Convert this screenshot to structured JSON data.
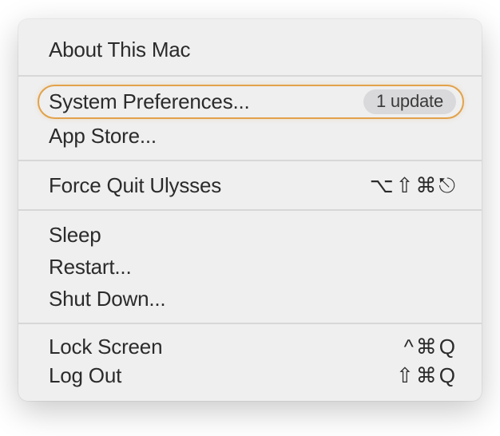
{
  "menu": {
    "about": {
      "label": "About This Mac"
    },
    "system_prefs": {
      "label": "System Preferences...",
      "badge": "1 update"
    },
    "app_store": {
      "label": "App Store..."
    },
    "force_quit": {
      "label": "Force Quit Ulysses",
      "shortcut": "⌥⇧⌘⎋"
    },
    "sleep": {
      "label": "Sleep"
    },
    "restart": {
      "label": "Restart..."
    },
    "shutdown": {
      "label": "Shut Down..."
    },
    "lock_screen": {
      "label": "Lock Screen",
      "shortcut": "^⌘Q"
    },
    "log_out": {
      "label": "Log Out",
      "shortcut": "⇧⌘Q"
    }
  }
}
